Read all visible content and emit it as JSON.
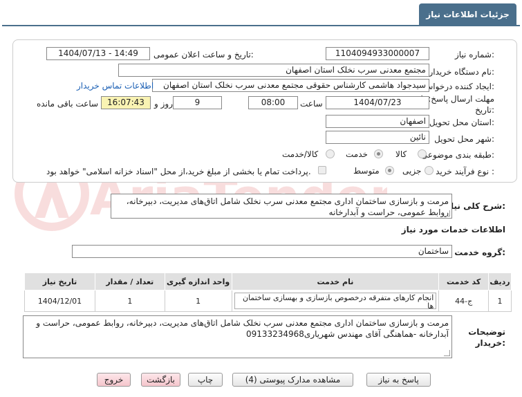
{
  "header": {
    "title": "جزئیات اطلاعات نیاز"
  },
  "form": {
    "need_number_label": "شماره نیاز:",
    "need_number": "1104094933000007",
    "announce_datetime_label": "تاریخ و ساعت اعلان عمومی:",
    "announce_datetime": "1404/07/13 - 14:49",
    "buyer_org_label": "نام دستگاه خریدار:",
    "buyer_org": "مجتمع معدنی سرب نخلک استان اصفهان",
    "creator_label": "ایجاد کننده درخواست:",
    "creator": "سیدجواد هاشمی کارشناس حقوقی مجتمع معدنی سرب نخلک استان اصفهان",
    "contact_link": "اطلاعات تماس خریدار",
    "deadline_label_1": "مهلت ارسال پاسخ: تا",
    "deadline_label_2": "تاریخ:",
    "deadline_date": "1404/07/23",
    "time_label": "ساعت",
    "deadline_time": "08:00",
    "days_value": "9",
    "days_label": "روز و",
    "remaining_time": "16:07:43",
    "remaining_label": "ساعت باقی مانده",
    "province_label": "استان محل تحویل:",
    "province": "اصفهان",
    "city_label": "شهر محل تحویل:",
    "city": "نائین",
    "category_label": "طبقه بندی موضوعی:",
    "category_options": {
      "goods": "کالا",
      "service": "خدمت",
      "goods_service": "کالا/خدمت"
    },
    "process_label": "نوع فرآیند خرید :",
    "process_options": {
      "partial": "جزیی",
      "medium": "متوسط"
    },
    "payment_note": "پرداخت تمام یا بخشی از مبلغ خرید،از محل \"اسناد خزانه اسلامی\" خواهد بود."
  },
  "summary": {
    "label": "شرح کلی نیاز:",
    "text": "مرمت و بازسازی ساختمان اداری مجتمع معدنی سرب نخلک شامل اتاق‌های مدیریت، دبیرخانه، روابط عمومی، حراست  و آبدارخانه"
  },
  "services": {
    "section_title": "اطلاعات خدمات مورد نیاز",
    "group_label": "گروه خدمت:",
    "group_value": "ساختمان",
    "columns": [
      "ردیف",
      "کد خدمت",
      "نام خدمت",
      "واحد اندازه گیری",
      "تعداد / مقدار",
      "تاریخ نیاز"
    ],
    "rows": [
      {
        "row": "1",
        "code": "ج-44",
        "name": "انجام کارهای متفرقه درخصوص بازسازی و بهسازی ساختمان ها",
        "unit": "1",
        "qty": "1",
        "date": "1404/12/01"
      }
    ]
  },
  "buyer_notes": {
    "label_1": "توضیحات",
    "label_2": "خریدار:",
    "text": "مرمت و بازسازی ساختمان اداری مجتمع معدنی سرب نخلک شامل اتاق‌های مدیریت، دبیرخانه، روابط عمومی، حراست  و آبدارخانه -هماهنگی آقای مهندس شهریاری09133234968"
  },
  "buttons": {
    "reply": "پاسخ به نیاز",
    "attachments": "مشاهده مدارک پیوستی (4)",
    "print": "چاپ",
    "back": "بازگشت",
    "exit": "خروج"
  },
  "watermark": "AriaTender.net",
  "colors": {
    "header": "#4a6f8c",
    "link": "#1a5fb4",
    "remaining_bg": "#f9f3b3",
    "exit_button": "#f5c5cc"
  }
}
